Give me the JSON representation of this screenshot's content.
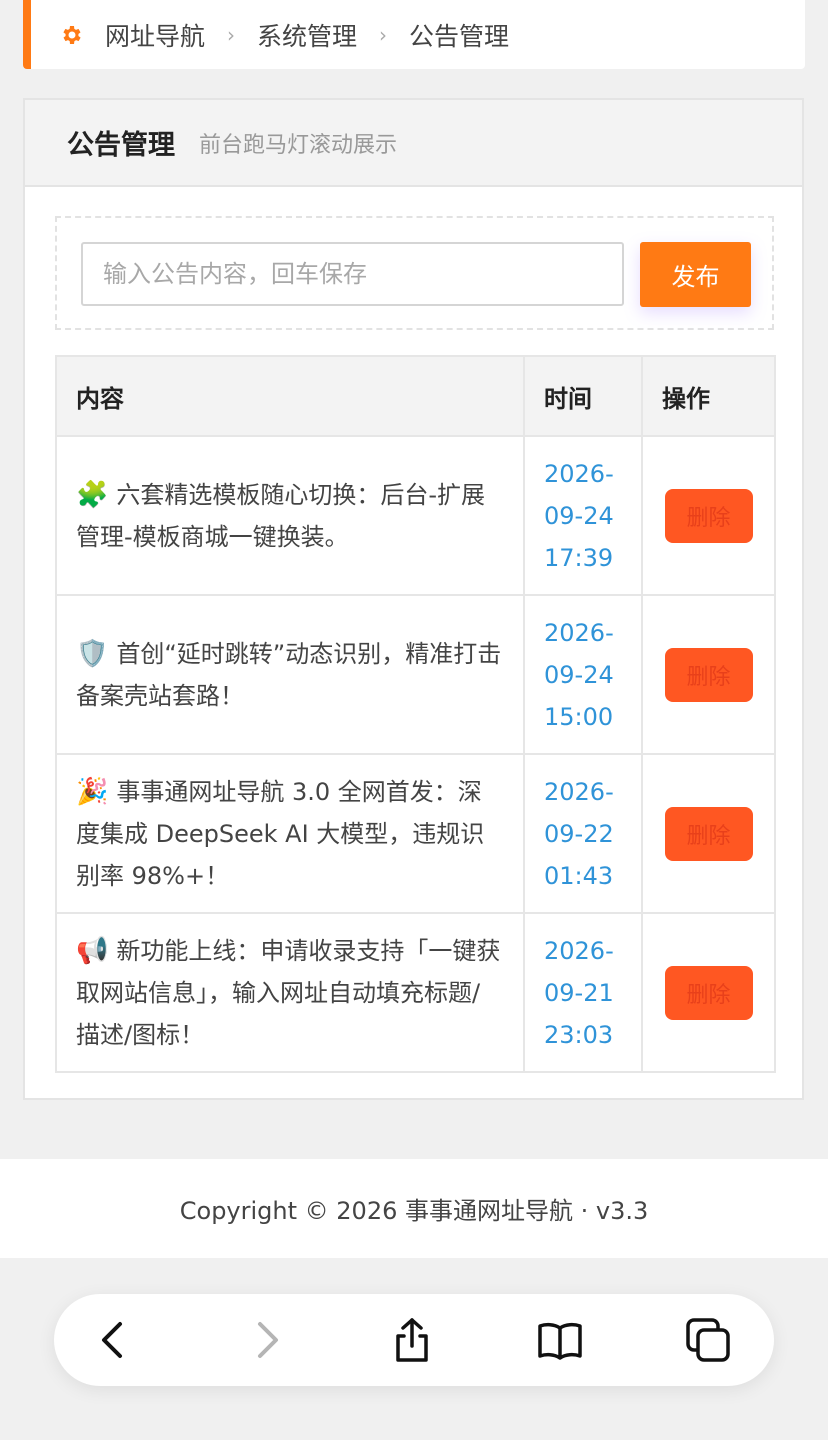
{
  "breadcrumb": {
    "items": [
      "网址导航",
      "系统管理",
      "公告管理"
    ],
    "separator": "›",
    "icon": "gear-icon",
    "accent_color": "#ff7a14"
  },
  "panel": {
    "title": "公告管理",
    "subtitle": "前台跑马灯滚动展示"
  },
  "form": {
    "input_placeholder": "输入公告内容，回车保存",
    "input_value": "",
    "publish_label": "发布"
  },
  "table": {
    "headers": [
      "内容",
      "时间",
      "操作"
    ],
    "rows": [
      {
        "emoji": "🧩",
        "content": "六套精选模板随心切换：后台-扩展管理-模板商城一键换装。",
        "time": "2026-09-24 17:39",
        "action": "删除"
      },
      {
        "emoji": "🛡️",
        "content": "首创“延时跳转”动态识别，精准打击备案壳站套路！",
        "time": "2026-09-24 15:00",
        "action": "删除"
      },
      {
        "emoji": "🎉",
        "content": "事事通网址导航 3.0 全网首发：深度集成 DeepSeek AI 大模型，违规识别率 98%+！",
        "time": "2026-09-22 01:43",
        "action": "删除"
      },
      {
        "emoji": "📢",
        "content": "新功能上线：申请收录支持「一键获取网站信息」，输入网址自动填充标题/描述/图标！",
        "time": "2026-09-21 23:03",
        "action": "删除"
      }
    ]
  },
  "footer": {
    "copyright": "Copyright © 2026 事事通网址导航 · v3.3"
  },
  "browser_toolbar": {
    "icons": [
      "back-icon",
      "forward-icon",
      "share-icon",
      "bookmarks-icon",
      "tabs-icon"
    ]
  }
}
